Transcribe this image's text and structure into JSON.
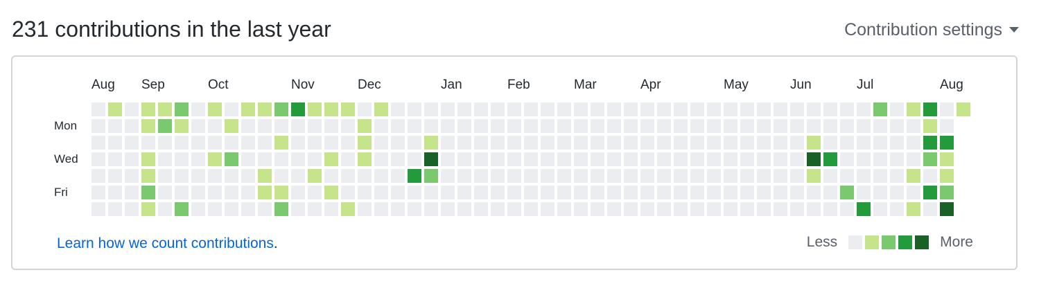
{
  "header": {
    "title": "231 contributions in the last year",
    "settings_label": "Contribution settings"
  },
  "calendar": {
    "months": [
      {
        "label": "Aug",
        "week": 0
      },
      {
        "label": "Sep",
        "week": 3
      },
      {
        "label": "Oct",
        "week": 7
      },
      {
        "label": "Nov",
        "week": 12
      },
      {
        "label": "Dec",
        "week": 16
      },
      {
        "label": "Jan",
        "week": 21
      },
      {
        "label": "Feb",
        "week": 25
      },
      {
        "label": "Mar",
        "week": 29
      },
      {
        "label": "Apr",
        "week": 33
      },
      {
        "label": "May",
        "week": 38
      },
      {
        "label": "Jun",
        "week": 42
      },
      {
        "label": "Jul",
        "week": 46
      },
      {
        "label": "Aug",
        "week": 51
      }
    ],
    "day_labels": [
      {
        "label": "Mon",
        "row": 1
      },
      {
        "label": "Wed",
        "row": 3
      },
      {
        "label": "Fri",
        "row": 5
      }
    ],
    "colors": [
      "#ebedf0",
      "#c6e48b",
      "#7bc96f",
      "#239a3b",
      "#196127"
    ],
    "weeks": 53,
    "last_week_days": 1,
    "levels": [
      "0100000000000000000000000000000000000000000000000000",
      "0000000000000000000000000000000000000000000000000000",
      "0000000000000000000000000000000000000000000000000000",
      "0000000000000000000000000000000000000000000000000000",
      "0000000000000000000000000000000000000000000000000000",
      "0000000000000000000000000000000000000000000000000000",
      "0000000000000000000000000000000000000000000000000000"
    ],
    "cells": [
      [
        1,
        0,
        1
      ],
      [
        3,
        0,
        1
      ],
      [
        4,
        0,
        1
      ],
      [
        5,
        0,
        2
      ],
      [
        7,
        0,
        1
      ],
      [
        9,
        0,
        1
      ],
      [
        10,
        0,
        1
      ],
      [
        11,
        0,
        2
      ],
      [
        12,
        0,
        3
      ],
      [
        13,
        0,
        1
      ],
      [
        14,
        0,
        1
      ],
      [
        15,
        0,
        1
      ],
      [
        17,
        0,
        1
      ],
      [
        47,
        0,
        2
      ],
      [
        49,
        0,
        1
      ],
      [
        50,
        0,
        3
      ],
      [
        52,
        0,
        1
      ],
      [
        3,
        1,
        1
      ],
      [
        4,
        1,
        2
      ],
      [
        5,
        1,
        1
      ],
      [
        8,
        1,
        1
      ],
      [
        16,
        1,
        1
      ],
      [
        50,
        1,
        1
      ],
      [
        11,
        2,
        1
      ],
      [
        16,
        2,
        1
      ],
      [
        20,
        2,
        1
      ],
      [
        43,
        2,
        1
      ],
      [
        50,
        2,
        3
      ],
      [
        51,
        2,
        3
      ],
      [
        3,
        3,
        1
      ],
      [
        7,
        3,
        1
      ],
      [
        8,
        3,
        2
      ],
      [
        14,
        3,
        1
      ],
      [
        16,
        3,
        1
      ],
      [
        20,
        3,
        4
      ],
      [
        43,
        3,
        4
      ],
      [
        44,
        3,
        3
      ],
      [
        50,
        3,
        2
      ],
      [
        51,
        3,
        1
      ],
      [
        3,
        4,
        1
      ],
      [
        10,
        4,
        1
      ],
      [
        13,
        4,
        1
      ],
      [
        19,
        4,
        3
      ],
      [
        20,
        4,
        2
      ],
      [
        43,
        4,
        1
      ],
      [
        49,
        4,
        1
      ],
      [
        51,
        4,
        1
      ],
      [
        3,
        5,
        2
      ],
      [
        10,
        5,
        1
      ],
      [
        11,
        5,
        1
      ],
      [
        14,
        5,
        1
      ],
      [
        45,
        5,
        2
      ],
      [
        50,
        5,
        3
      ],
      [
        51,
        5,
        2
      ],
      [
        3,
        6,
        1
      ],
      [
        5,
        6,
        2
      ],
      [
        11,
        6,
        2
      ],
      [
        15,
        6,
        1
      ],
      [
        46,
        6,
        3
      ],
      [
        49,
        6,
        1
      ],
      [
        51,
        6,
        4
      ]
    ]
  },
  "footer": {
    "learn_link": "Learn how we count contributions",
    "learn_suffix": ".",
    "legend_less": "Less",
    "legend_more": "More"
  }
}
